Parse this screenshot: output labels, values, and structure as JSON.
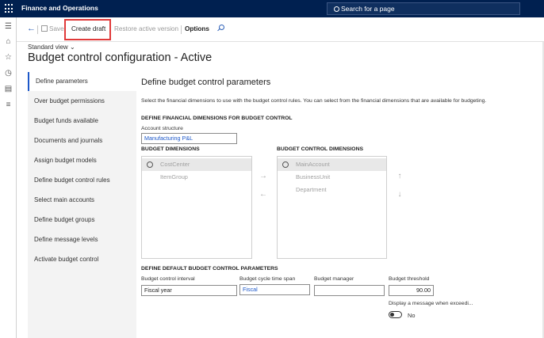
{
  "app": {
    "title": "Finance and Operations"
  },
  "search": {
    "placeholder": "Search for a page"
  },
  "rail": {
    "icons": [
      "hamburger-icon",
      "home-icon",
      "star-icon",
      "clock-icon",
      "workspace-icon",
      "list-icon"
    ]
  },
  "toolbar": {
    "save_label": "Save",
    "create_draft_label": "Create draft",
    "restore_label": "Restore active version",
    "options_label": "Options"
  },
  "view": {
    "label": "Standard view"
  },
  "page": {
    "title": "Budget control configuration - Active"
  },
  "tabs": [
    "Define parameters",
    "Over budget permissions",
    "Budget funds available",
    "Documents and journals",
    "Assign budget models",
    "Define budget control rules",
    "Select main accounts",
    "Define budget groups",
    "Define message levels",
    "Activate budget control"
  ],
  "content": {
    "section_title": "Define budget control parameters",
    "instruction": "Select the financial dimensions to use with the budget control rules. You can select from the financial dimensions that are available for budgeting.",
    "fin_dims_heading": "DEFINE FINANCIAL DIMENSIONS FOR BUDGET CONTROL",
    "account_structure_label": "Account structure",
    "account_structure_value": "Manufacturing P&L",
    "budget_dims_heading": "BUDGET DIMENSIONS",
    "budget_dims_items": [
      "CostCenter",
      "ItemGroup"
    ],
    "budget_control_dims_heading": "BUDGET CONTROL DIMENSIONS",
    "budget_control_dims_items": [
      "MainAccount",
      "BusinessUnit",
      "Department"
    ],
    "default_params_heading": "DEFINE DEFAULT BUDGET CONTROL PARAMETERS",
    "interval_label": "Budget control interval",
    "interval_value": "Fiscal year",
    "cycle_label": "Budget cycle time span",
    "cycle_value": "Fiscal",
    "manager_label": "Budget manager",
    "manager_value": "",
    "threshold_label": "Budget threshold",
    "threshold_value": "90.00",
    "display_msg_label": "Display a message when exceedi...",
    "toggle_value": "No"
  }
}
